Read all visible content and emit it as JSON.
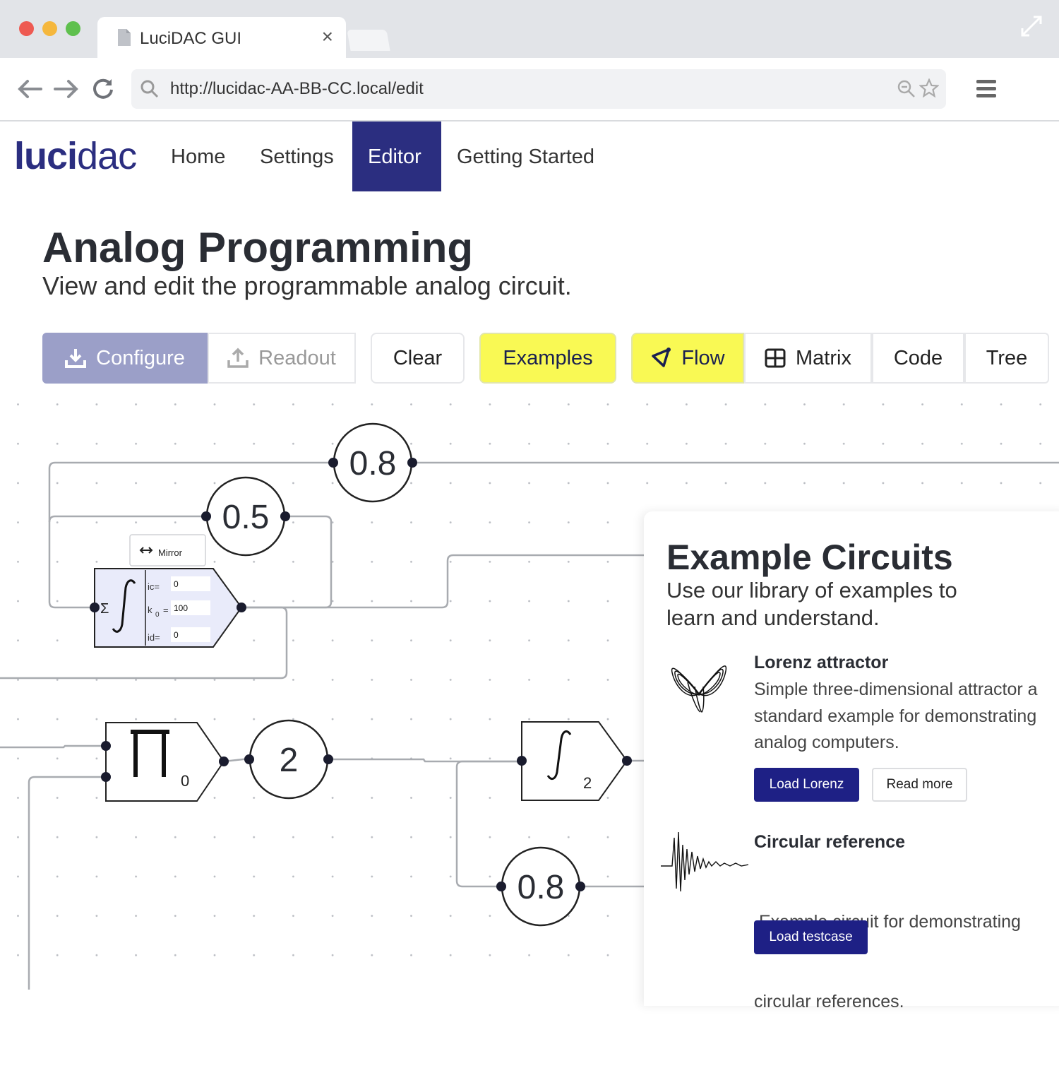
{
  "browser": {
    "tab_title": "LuciDAC GUI",
    "tab_close": "×",
    "url": "http://lucidac-AA-BB-CC.local/edit"
  },
  "site": {
    "logo_bold": "luci",
    "logo_light": "dac",
    "nav": [
      {
        "label": "Home",
        "active": false
      },
      {
        "label": "Settings",
        "active": false
      },
      {
        "label": "Editor",
        "active": true
      },
      {
        "label": "Getting Started",
        "active": false
      }
    ]
  },
  "page": {
    "title": "Analog Programming",
    "subtitle": "View and edit the programmable analog circuit."
  },
  "toolbar": {
    "configure": "Configure",
    "readout": "Readout",
    "clear": "Clear",
    "examples": "Examples",
    "flow": "Flow",
    "matrix": "Matrix",
    "code": "Code",
    "tree": "Tree"
  },
  "circuit": {
    "coefficients": [
      "0.8",
      "0.5",
      "2",
      "0.8"
    ],
    "mirror_label": "Mirror",
    "integrator": {
      "sum_symbol": "Σ",
      "ic_label": "ic=",
      "ic_value": "0",
      "k0_label": "k",
      "k0_sub": "0",
      "k0_eq": "=",
      "k0_value": "100",
      "id_label": "id=",
      "id_value": "0"
    },
    "multiplier": {
      "symbol": "Π",
      "index": "0"
    },
    "integrator2": {
      "symbol": "∫",
      "index": "2"
    }
  },
  "examples_panel": {
    "title": "Example Circuits",
    "subtitle_line1": "Use our library of examples to",
    "subtitle_line2": "learn and understand.",
    "items": [
      {
        "title": "Lorenz attractor",
        "desc_lines": [
          "Simple three-dimensional attractor a",
          "standard example for demonstrating",
          "analog computers."
        ],
        "primary_button": "Load Lorenz",
        "secondary_button": "Read more"
      },
      {
        "title": "Circular reference",
        "desc_lines": [
          " Example circuit for demonstrating",
          "circular references."
        ],
        "primary_button": "Load testcase"
      }
    ]
  },
  "colors": {
    "brand": "#2b2e80",
    "highlight": "#f9f954",
    "configure_button": "#9b9fc8",
    "primary_button": "#1e2085"
  }
}
